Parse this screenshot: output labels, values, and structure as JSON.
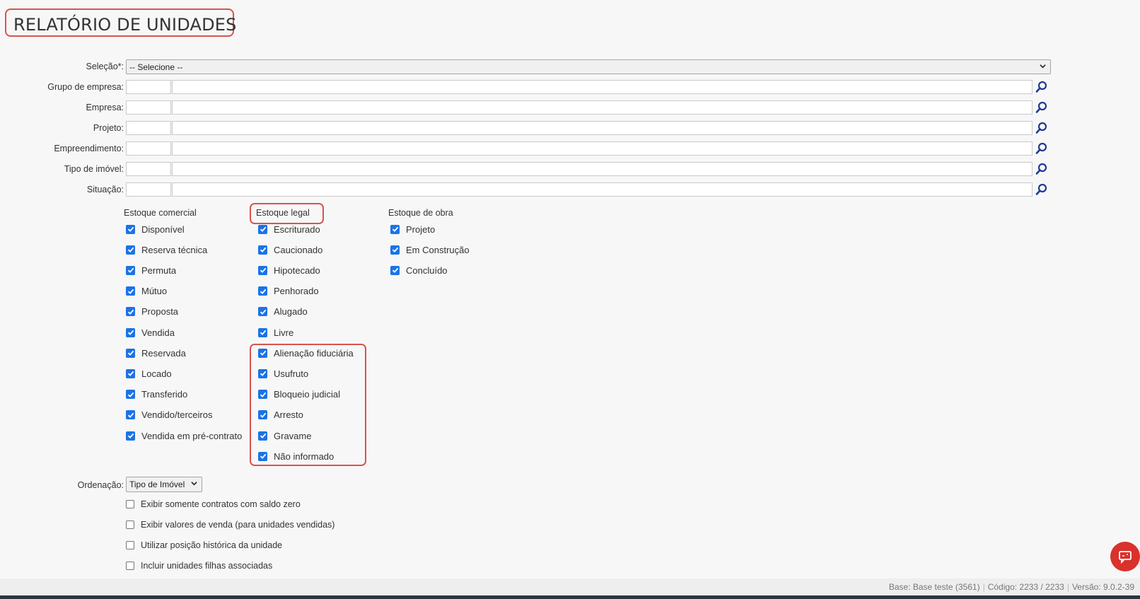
{
  "page": {
    "title": "RELATÓRIO DE UNIDADES"
  },
  "selecao": {
    "label": "Seleção*:",
    "value": "-- Selecione --"
  },
  "filters": [
    {
      "label": "Grupo de empresa:"
    },
    {
      "label": "Empresa:"
    },
    {
      "label": "Projeto:"
    },
    {
      "label": "Empreendimento:"
    },
    {
      "label": "Tipo de imóvel:"
    },
    {
      "label": "Situação:"
    }
  ],
  "estoque_comercial": {
    "header": "Estoque comercial",
    "items": [
      "Disponível",
      "Reserva técnica",
      "Permuta",
      "Mútuo",
      "Proposta",
      "Vendida",
      "Reservada",
      "Locado",
      "Transferido",
      "Vendido/terceiros",
      "Vendida em pré-contrato"
    ]
  },
  "estoque_legal": {
    "header": "Estoque legal",
    "items": [
      "Escriturado",
      "Caucionado",
      "Hipotecado",
      "Penhorado",
      "Alugado",
      "Livre",
      "Alienação fiduciária",
      "Usufruto",
      "Bloqueio judicial",
      "Arresto",
      "Gravame",
      "Não informado"
    ]
  },
  "estoque_obra": {
    "header": "Estoque de obra",
    "items": [
      "Projeto",
      "Em Construção",
      "Concluído"
    ]
  },
  "ordenacao": {
    "label": "Ordenação:",
    "value": "Tipo de Imóvel"
  },
  "options": [
    "Exibir somente contratos com saldo zero",
    "Exibir valores de venda (para unidades vendidas)",
    "Utilizar posição histórica da unidade",
    "Incluir unidades filhas associadas"
  ],
  "footer": {
    "base": "Base: Base teste (3561)",
    "codigo": "Código: 2233 / 2233",
    "versao": "Versão: 9.0.2-39"
  },
  "colors": {
    "checkbox": "#1a73e8",
    "highlight": "#d9534f",
    "search_icon": "#1f3a93",
    "chat": "#d9312b"
  }
}
